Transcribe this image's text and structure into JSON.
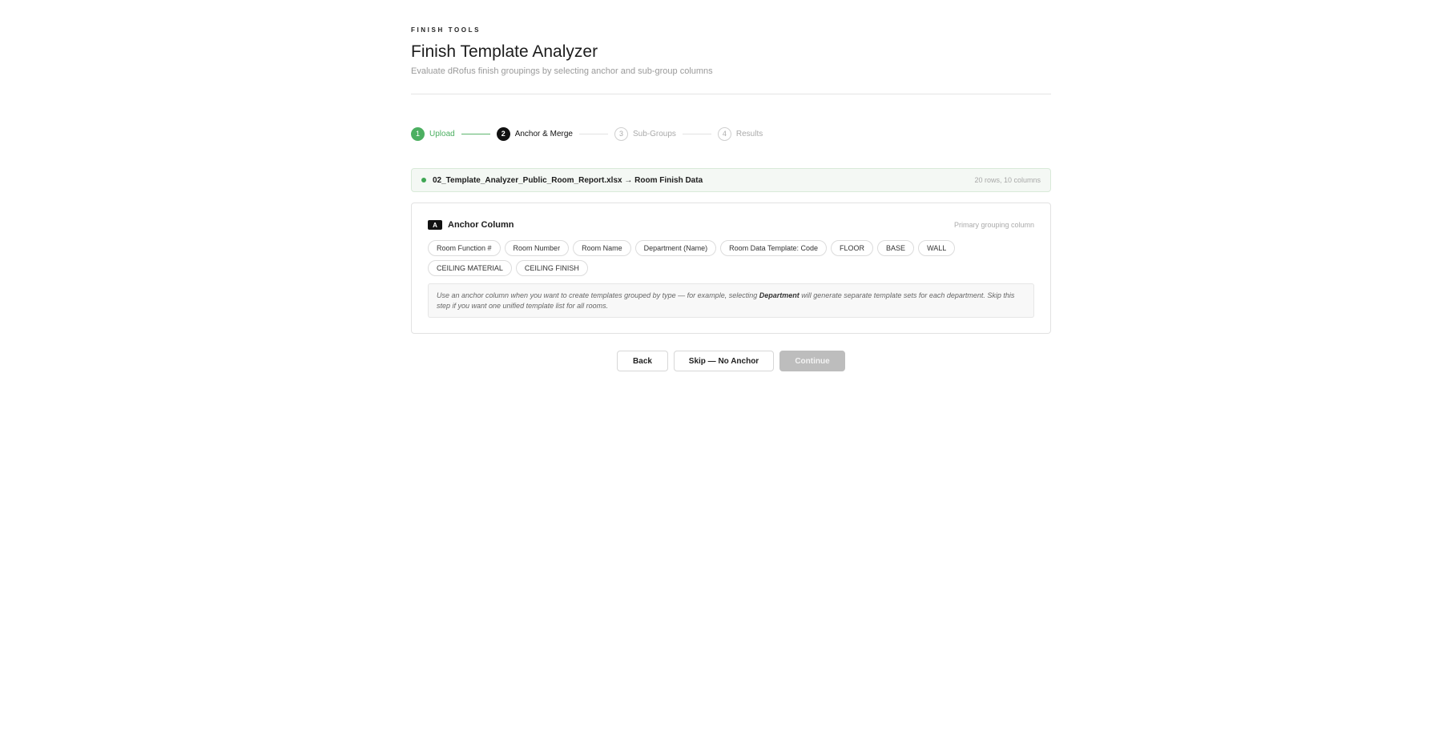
{
  "header": {
    "eyebrow": "FINISH TOOLS",
    "title": "Finish Template Analyzer",
    "subtitle": "Evaluate dRofus finish groupings by selecting anchor and sub-group columns"
  },
  "stepper": {
    "steps": [
      {
        "num": "1",
        "label": "Upload",
        "state": "done"
      },
      {
        "num": "2",
        "label": "Anchor & Merge",
        "state": "active"
      },
      {
        "num": "3",
        "label": "Sub-Groups",
        "state": "todo"
      },
      {
        "num": "4",
        "label": "Results",
        "state": "todo"
      }
    ]
  },
  "file": {
    "name": "02_Template_Analyzer_Public_Room_Report.xlsx → Room Finish Data",
    "meta": "20 rows, 10 columns"
  },
  "anchor": {
    "badge": "A",
    "title": "Anchor Column",
    "hint": "Primary grouping column",
    "columns": [
      "Room Function #",
      "Room Number",
      "Room Name",
      "Department (Name)",
      "Room Data Template: Code",
      "FLOOR",
      "BASE",
      "WALL",
      "CEILING MATERIAL",
      "CEILING FINISH"
    ],
    "note_before": "Use an anchor column when you want to create templates grouped by type — for example, selecting ",
    "note_bold": "Department",
    "note_after": " will generate separate template sets for each department. Skip this step if you want one unified template list for all rooms."
  },
  "actions": {
    "back": "Back",
    "skip": "Skip — No Anchor",
    "continue": "Continue"
  },
  "colors": {
    "success": "#4caf61",
    "active": "#111111",
    "disabled": "#bdbdbd"
  }
}
